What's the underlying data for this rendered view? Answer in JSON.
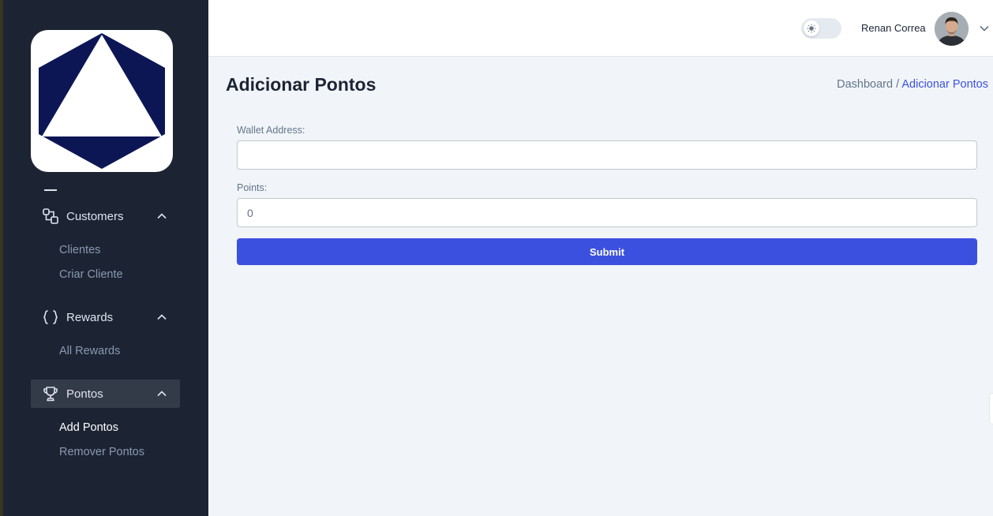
{
  "header": {
    "user_name": "Renan Correa",
    "theme_toggle_icon": "sun-icon",
    "user_menu_icon": "chevron-down-icon"
  },
  "sidebar": {
    "logo_icon": "triangle-hexagon-logo",
    "groups": [
      {
        "label": "Customers",
        "icon": "users-icon",
        "expanded": true,
        "items": [
          {
            "label": "Clientes"
          },
          {
            "label": "Criar Cliente"
          }
        ]
      },
      {
        "label": "Rewards",
        "icon": "curly-braces-icon",
        "expanded": true,
        "items": [
          {
            "label": "All Rewards"
          }
        ]
      },
      {
        "label": "Pontos",
        "icon": "trophy-icon",
        "expanded": true,
        "active": true,
        "items": [
          {
            "label": "Add Pontos",
            "active": true
          },
          {
            "label": "Remover Pontos"
          }
        ]
      }
    ]
  },
  "main": {
    "title": "Adicionar Pontos",
    "breadcrumb": {
      "parent": "Dashboard",
      "separator": "/",
      "current": "Adicionar Pontos"
    },
    "form": {
      "wallet_label": "Wallet Address:",
      "wallet_value": "",
      "points_label": "Points:",
      "points_value": "0",
      "submit_label": "Submit"
    }
  },
  "colors": {
    "sidebar_bg": "#1c2434",
    "primary": "#3c50e0",
    "page_bg": "#f1f5f9",
    "logo_navy": "#0d1655"
  }
}
